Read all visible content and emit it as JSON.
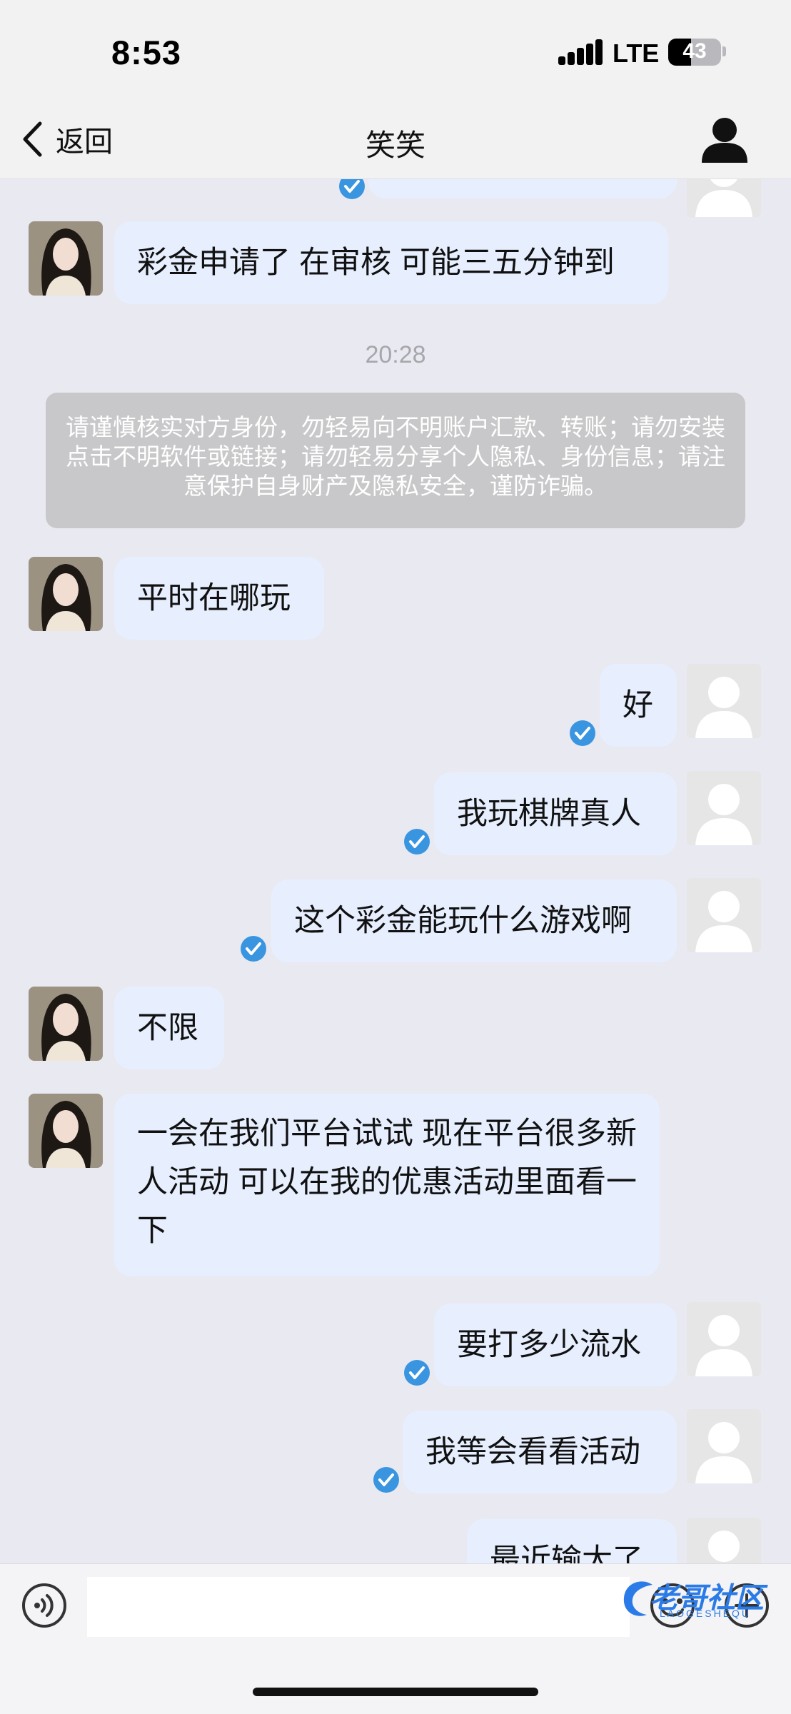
{
  "status": {
    "time": "8:53",
    "network": "LTE",
    "battery": "43",
    "battery_level": 0.43
  },
  "nav": {
    "back_label": "返回",
    "title": "笑笑"
  },
  "chat": {
    "messages": [
      {
        "from": "other",
        "text": "彩金申请了 在审核 可能三五分钟到"
      },
      {
        "type": "timestamp",
        "text": "20:28"
      },
      {
        "type": "notice",
        "text": "请谨慎核实对方身份，勿轻易向不明账户汇款、转账；请勿安装点击不明软件或链接；请勿轻易分享个人隐私、身份信息；请注意保护自身财产及隐私安全，谨防诈骗。"
      },
      {
        "from": "other",
        "text": "平时在哪玩"
      },
      {
        "from": "me",
        "text": "好"
      },
      {
        "from": "me",
        "text": "我玩棋牌真人"
      },
      {
        "from": "me",
        "text": "这个彩金能玩什么游戏啊"
      },
      {
        "from": "other",
        "text": "不限"
      },
      {
        "from": "other",
        "text": "一会在我们平台试试 现在平台很多新人活动 可以在我的优惠活动里面看一下"
      },
      {
        "from": "me",
        "text": "要打多少流水"
      },
      {
        "from": "me",
        "text": "我等会看看活动"
      },
      {
        "from": "me",
        "text": "最近输太了"
      }
    ]
  },
  "watermark": {
    "text": "老哥社区",
    "sub": "LAOGESHEQU"
  },
  "icons": {
    "back": "chevron-left-icon",
    "profile": "person-icon",
    "voice": "voice-icon",
    "emoji": "emoji-icon",
    "plus": "plus-icon",
    "read": "check-circle-icon"
  },
  "colors": {
    "bubble": "#e7effe",
    "chat_background": "#e9e9f2",
    "check": "#3a95e0",
    "notice": "#c8c8ca"
  }
}
